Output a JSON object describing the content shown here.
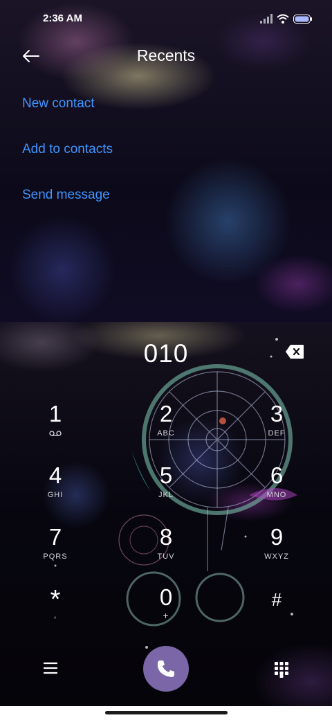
{
  "status_bar": {
    "time": "2:36 AM",
    "icons": [
      "signal-icon",
      "wifi-icon",
      "battery-icon"
    ],
    "battery_color": "#a9b8ff"
  },
  "header": {
    "title": "Recents",
    "back_icon": "arrow-left-icon"
  },
  "options": [
    {
      "label": "New contact"
    },
    {
      "label": "Add to contacts"
    },
    {
      "label": "Send message"
    }
  ],
  "colors": {
    "link": "#3f95ff",
    "call_button": "#7b67a8"
  },
  "dialer": {
    "number": "010",
    "backspace_icon": "backspace-icon"
  },
  "keypad": [
    {
      "digit": "1",
      "letters": "",
      "icon": "voicemail-icon"
    },
    {
      "digit": "2",
      "letters": "ABC"
    },
    {
      "digit": "3",
      "letters": "DEF"
    },
    {
      "digit": "4",
      "letters": "GHI"
    },
    {
      "digit": "5",
      "letters": "JKL"
    },
    {
      "digit": "6",
      "letters": "MNO"
    },
    {
      "digit": "7",
      "letters": "PQRS"
    },
    {
      "digit": "8",
      "letters": "TUV"
    },
    {
      "digit": "9",
      "letters": "WXYZ"
    },
    {
      "digit": "*",
      "letters": ","
    },
    {
      "digit": "0",
      "letters": "+"
    },
    {
      "digit": "#",
      "letters": ""
    }
  ],
  "bottom_bar": {
    "left_icon": "menu-icon",
    "center_icon": "phone-icon",
    "right_icon": "dialpad-icon"
  }
}
